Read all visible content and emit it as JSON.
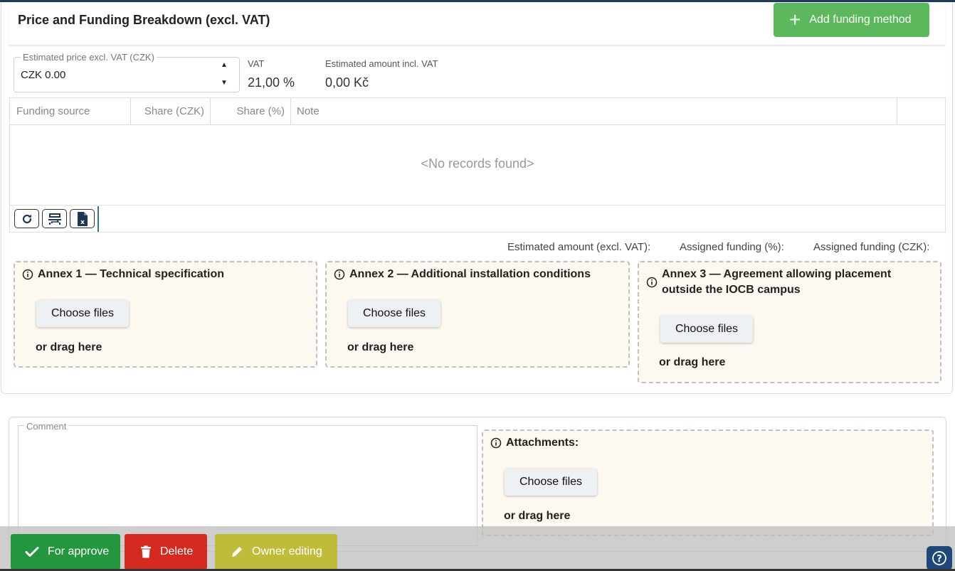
{
  "header": {
    "title": "Price and Funding Breakdown (excl. VAT)",
    "add_funding_label": "Add funding method"
  },
  "price": {
    "legend": "Estimated price excl. VAT (CZK)",
    "value": "CZK 0.00",
    "vat_label": "VAT",
    "vat_value": "21,00 %",
    "incl_label": "Estimated amount incl. VAT",
    "incl_value": "0,00 Kč"
  },
  "grid": {
    "columns": [
      "Funding source",
      "Share (CZK)",
      "Share (%)",
      "Note"
    ],
    "empty_text": "<No records found>",
    "toolbar": [
      "refresh-icon",
      "fit-columns-icon",
      "excel-export-icon"
    ]
  },
  "summary": {
    "estimated_amount_label": "Estimated amount (excl. VAT):",
    "assigned_pct_label": "Assigned funding (%):",
    "assigned_czk_label": "Assigned funding (CZK):"
  },
  "annexes": [
    {
      "title": "Annex 1 — Technical specification",
      "button": "Choose files",
      "drag": "or drag here"
    },
    {
      "title": "Annex 2 — Additional installation conditions",
      "button": "Choose files",
      "drag": "or drag here"
    },
    {
      "title": "Annex 3 — Agreement allowing placement outside the IOCB campus",
      "button": "Choose files",
      "drag": "or drag here"
    }
  ],
  "comment": {
    "legend": "Comment",
    "value": ""
  },
  "attachments": {
    "title": "Attachments:",
    "button": "Choose files",
    "drag": "or drag here"
  },
  "footer": {
    "approve_label": "For approve",
    "delete_label": "Delete",
    "owner_label": "Owner editing"
  },
  "colors": {
    "add_button": "#5cb85c",
    "approve": "#24963e",
    "delete": "#d42a1f",
    "owner": "#bfbc3a",
    "dropzone_bg": "#fdf8f0",
    "help": "#1d4a7a"
  }
}
